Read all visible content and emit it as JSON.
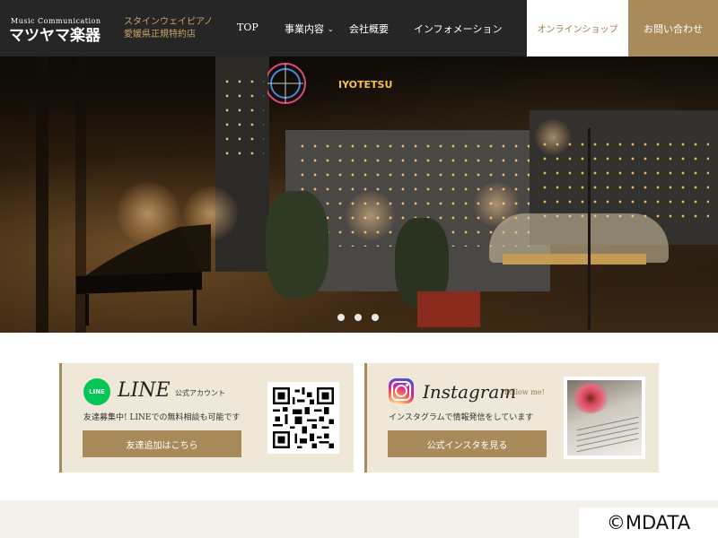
{
  "header": {
    "logo_top": "Music Communication",
    "logo_main": "マツヤマ楽器",
    "tagline": [
      "スタインウェイピアノ",
      "愛媛県正規特約店"
    ],
    "nav": {
      "top": "TOP",
      "business": "事業内容",
      "company": "会社概要",
      "information": "インフォメーション"
    },
    "shop_label": "オンラインショップ",
    "contact_label": "お問い合わせ"
  },
  "hero": {
    "slide_count": 3,
    "sign_iyotetsu": "IYOTETSU"
  },
  "line_banner": {
    "logo_text": "LINE",
    "title": "LINE",
    "subtitle": "公式アカウント",
    "description": "友達募集中! LINEでの無料相談も可能です",
    "button_label": "友達追加はこちら"
  },
  "insta_banner": {
    "title": "Instagram",
    "subtitle": "Follow me!",
    "description": "インスタグラムで情報発信をしています",
    "button_label": "公式インスタを見る"
  },
  "watermark": "©MDATA",
  "colors": {
    "header_bg": "#262626",
    "accent_gold": "#a98a5a",
    "banner_bg": "#efe7d8",
    "line_green": "#06c755"
  }
}
